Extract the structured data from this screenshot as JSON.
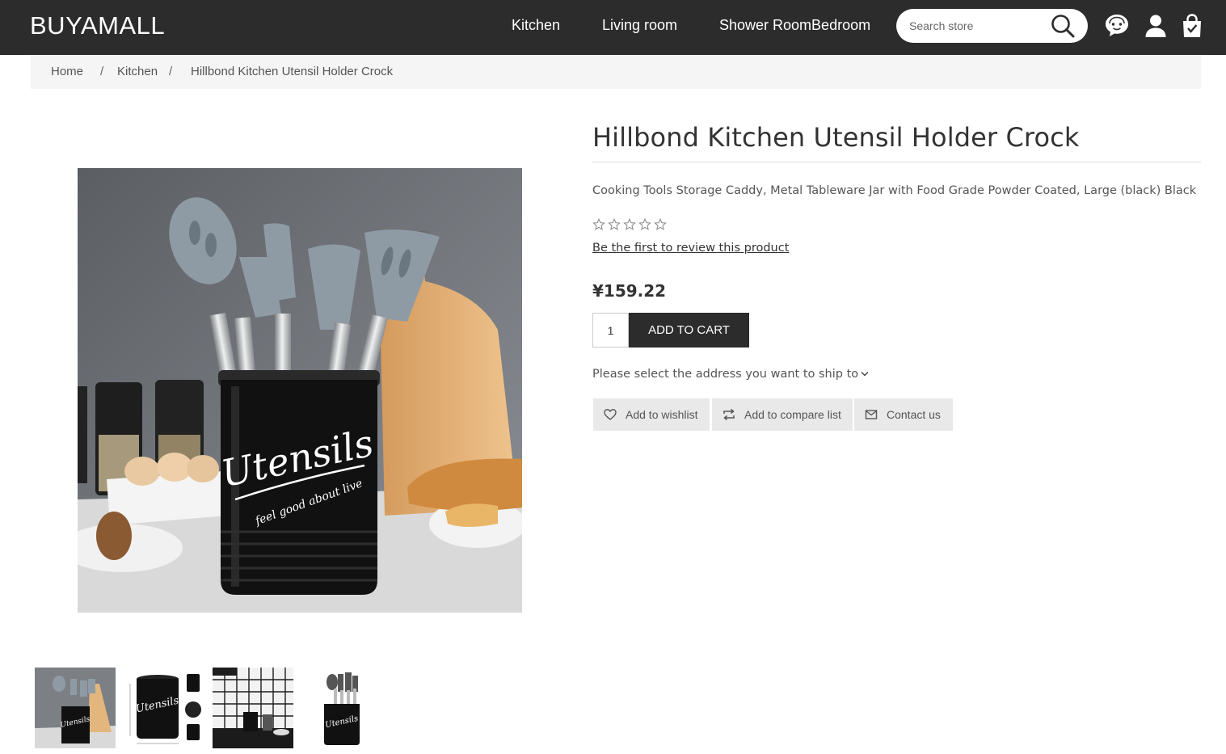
{
  "header": {
    "logo": "BUYAMALL",
    "nav": [
      "Kitchen",
      "Living room",
      "Shower RoomBedroom"
    ],
    "search_placeholder": "Search store",
    "icons": [
      "search-icon",
      "chat-icon",
      "user-icon",
      "cart-icon"
    ],
    "bg_color": "#2c2c2c"
  },
  "breadcrumb": [
    "Home",
    "Kitchen",
    "Hillbond Kitchen Utensil Holder Crock"
  ],
  "breadcrumb_separator": "/",
  "product": {
    "title": "Hillbond Kitchen Utensil Holder Crock",
    "subtitle": "Cooking Tools Storage Caddy, Metal Tableware Jar with Food Grade Powder Coated, Large (black) Black",
    "rating": 0,
    "rating_max": 5,
    "review_link": "Be the first to review this product",
    "price": "¥159.22",
    "qty": "1",
    "add_to_cart": "ADD TO CART",
    "ship_prompt": "Please select the address you want to ship to",
    "actions": [
      "Add to wishlist",
      "Add to compare list",
      "Contact us"
    ],
    "image_text": {
      "jar_brand": "Utensils",
      "jar_tagline": "feel good about live"
    }
  },
  "thumbnails": 4
}
